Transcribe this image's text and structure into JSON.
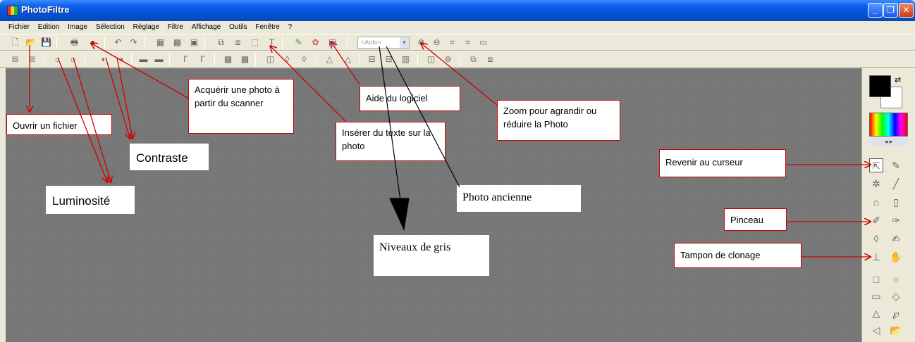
{
  "window": {
    "title": "PhotoFiltre",
    "minimize": "_",
    "maximize": "❐",
    "close": "✕"
  },
  "menu": [
    "Fichier",
    "Edition",
    "Image",
    "Sélection",
    "Réglage",
    "Filtre",
    "Affichage",
    "Outils",
    "Fenêtre",
    "?"
  ],
  "toolbar": {
    "zoom_value": "<Auto>"
  },
  "annotations": {
    "ouvrir": "Ouvrir un fichier",
    "acquerir": "Acquérir une photo à partir du scanner",
    "contraste": "Contraste",
    "luminosite": "Luminosité",
    "aide": "Aide du logiciel",
    "inserer_texte": "Insérer du texte sur la photo",
    "zoom": "Zoom pour agrandir ou réduire la Photo",
    "photo_ancienne": "Photo ancienne",
    "niveaux_gris": "Niveaux de gris",
    "revenir_curseur": "Revenir au curseur",
    "pinceau": "Pinceau",
    "tampon": "Tampon de clonage"
  },
  "palette_nav": "◂   ▸",
  "colors": {
    "annotation_arrow": "#d00000",
    "titlebar": "#0550d4",
    "workspace": "#7a7a7a"
  }
}
